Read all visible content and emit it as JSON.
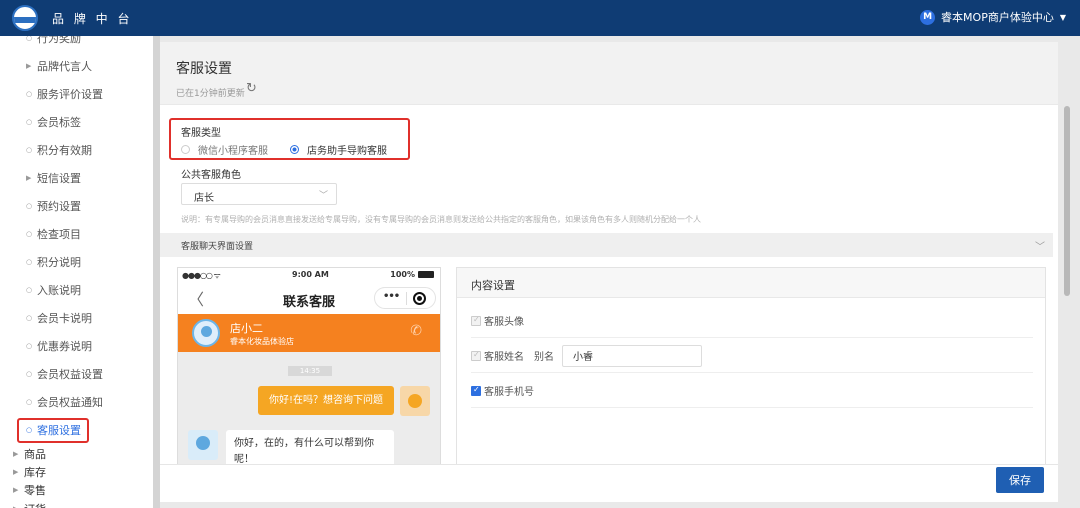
{
  "topbar": {
    "brand": "品 牌 中 台",
    "avatar_letter": "M",
    "user": "睿本MOP商户体验中心",
    "caret": "▼"
  },
  "sidebar": {
    "items": [
      {
        "label": "行为奖励"
      },
      {
        "label": "品牌代言人"
      },
      {
        "label": "服务评价设置"
      },
      {
        "label": "会员标签"
      },
      {
        "label": "积分有效期"
      },
      {
        "label": "短信设置"
      },
      {
        "label": "预约设置"
      },
      {
        "label": "检查项目"
      },
      {
        "label": "积分说明"
      },
      {
        "label": "入账说明"
      },
      {
        "label": "会员卡说明"
      },
      {
        "label": "优惠券说明"
      },
      {
        "label": "会员权益设置"
      },
      {
        "label": "会员权益通知"
      },
      {
        "label": "客服设置"
      },
      {
        "label": "商品"
      },
      {
        "label": "库存"
      },
      {
        "label": "零售"
      },
      {
        "label": "订货"
      }
    ]
  },
  "header": {
    "title": "客服设置",
    "updated": "已在1分钟前更新"
  },
  "service_type": {
    "label": "客服类型",
    "options": [
      "微信小程序客服",
      "店务助手导购客服"
    ],
    "selected": "店务助手导购客服"
  },
  "public_role": {
    "label": "公共客服角色",
    "value": "店长"
  },
  "note": "说明：有专属导购的会员消息直接发送给专属导购，没有专属导购的会员消息则发送给公共指定的客服角色，如果该角色有多人则随机分配给一个人",
  "chat_ui": {
    "label": "客服聊天界面设置"
  },
  "phone": {
    "status_left": "●●●○○ ᯤ",
    "time": "9:00 AM",
    "battery": "100%",
    "nav_title": "联系客服",
    "back": "〈",
    "capsule_dots": "•••",
    "agent_name": "店小二",
    "agent_store": "睿本化妆品体验店",
    "phone_icon": "✆",
    "timestamp": "14:35",
    "msg_user": "你好!在吗？想咨询下问题",
    "msg_agent": "你好，在的，有什么可以帮到你呢！"
  },
  "content_settings": {
    "title": "内容设置",
    "avatar": "客服头像",
    "name": "客服姓名",
    "alias_label": "别名",
    "alias_value": "小睿",
    "mobile": "客服手机号"
  },
  "footer": {
    "save": "保存"
  },
  "colors": {
    "topbar": "#0f3c74",
    "accent": "#2d6fe0",
    "orange": "#f5811f",
    "highlight": "#e0302b"
  }
}
